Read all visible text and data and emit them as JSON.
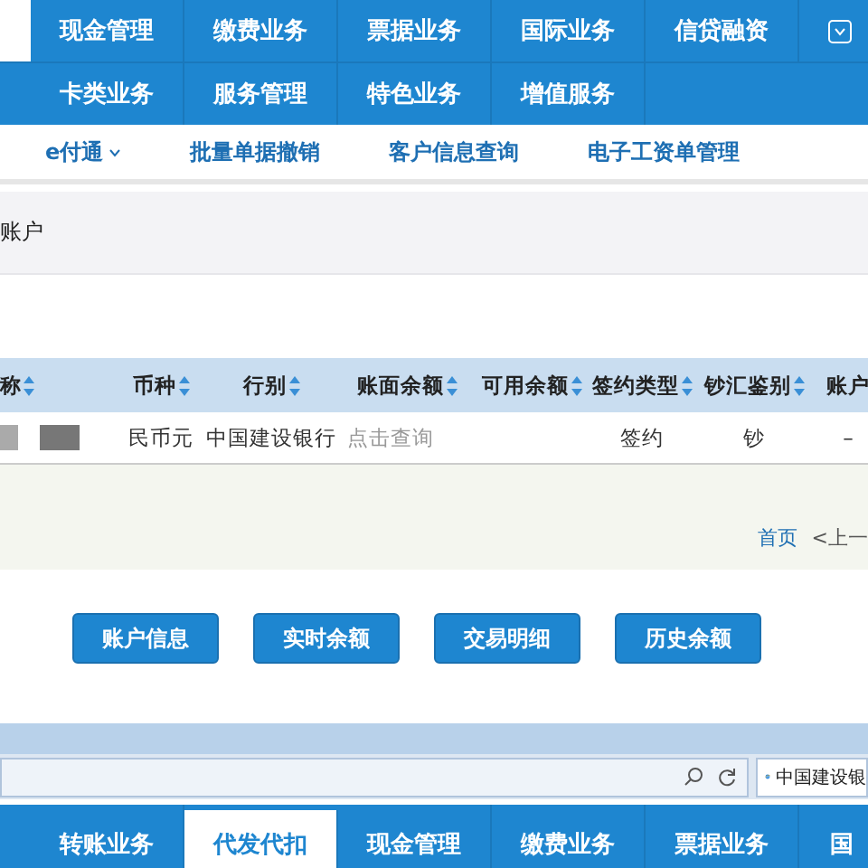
{
  "top_nav": {
    "row1": [
      {
        "label": "现金管理",
        "selected": false
      },
      {
        "label": "缴费业务",
        "selected": false
      },
      {
        "label": "票据业务",
        "selected": false
      },
      {
        "label": "国际业务",
        "selected": false
      },
      {
        "label": "信贷融资",
        "selected": false
      }
    ],
    "row2": [
      {
        "label": "卡类业务",
        "selected": false
      },
      {
        "label": "服务管理",
        "selected": false
      },
      {
        "label": "特色业务",
        "selected": false
      },
      {
        "label": "增值服务",
        "selected": false
      }
    ]
  },
  "sub_nav": [
    {
      "label": "e付通",
      "dropdown": true
    },
    {
      "label": "批量单据撤销",
      "dropdown": false
    },
    {
      "label": "客户信息查询",
      "dropdown": false
    },
    {
      "label": "电子工资单管理",
      "dropdown": false
    }
  ],
  "panel": {
    "title": "账户"
  },
  "table": {
    "columns": [
      "称",
      "币种",
      "行别",
      "账面余额",
      "可用余额",
      "签约类型",
      "钞汇鉴别",
      "账户"
    ],
    "rows": [
      {
        "cells": [
          "",
          "民币元",
          "中国建设银行",
          "点击查询",
          "",
          "签约",
          "钞",
          "–"
        ]
      }
    ]
  },
  "pagination": [
    {
      "label": "首页"
    },
    {
      "label": "<上一"
    }
  ],
  "buttons": [
    "账户信息",
    "实时余额",
    "交易明细",
    "历史余额"
  ],
  "browser": {
    "tab_title": "中国建设银"
  },
  "bottom_nav": [
    {
      "label": "转账业务",
      "selected": false
    },
    {
      "label": "代发代扣",
      "selected": true
    },
    {
      "label": "现金管理",
      "selected": false
    },
    {
      "label": "缴费业务",
      "selected": false
    },
    {
      "label": "票据业务",
      "selected": false
    },
    {
      "label": "国",
      "selected": false
    }
  ]
}
